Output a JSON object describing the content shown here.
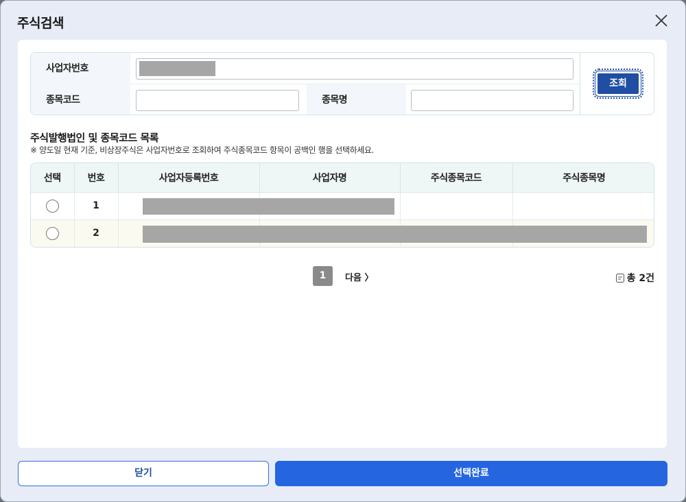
{
  "modal": {
    "title": "주식검색"
  },
  "search": {
    "biz_no_label": "사업자번호",
    "code_label": "종목코드",
    "name_label": "종목명",
    "biz_no_value": "",
    "code_value": "",
    "name_value": "",
    "search_button": "조회"
  },
  "list": {
    "title": "주식발행법인 및 종목코드 목록",
    "note": "※ 양도일 현재 기준, 비상장주식은 사업자번호로 조회하여 주식종목코드 항목이 공백인 행을 선택하세요.",
    "columns": [
      "선택",
      "번호",
      "사업자등록번호",
      "사업자명",
      "주식종목코드",
      "주식종목명"
    ],
    "rows": [
      {
        "no": "1",
        "biz_reg_no": "",
        "biz_name": "",
        "stock_code": "",
        "stock_name": ""
      },
      {
        "no": "2",
        "biz_reg_no": "",
        "biz_name": "",
        "stock_code": "",
        "stock_name": ""
      }
    ]
  },
  "pagination": {
    "current": "1",
    "next_label": "다음 〉",
    "total": "총 2건"
  },
  "footer": {
    "close_label": "닫기",
    "confirm_label": "선택완료"
  },
  "colors": {
    "primary": "#2566e0",
    "dark_button": "#1f4ea3",
    "header_bg": "#eef7f5"
  }
}
